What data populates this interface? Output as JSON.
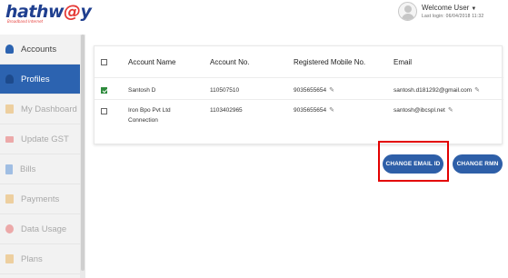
{
  "header": {
    "logo_main": "hathw",
    "logo_at": "@",
    "logo_end": "y",
    "logo_tagline": "Broadband Internet",
    "welcome": "Welcome User",
    "user_sub": "Last login: 06/04/2018 11:32"
  },
  "sidebar": {
    "items": [
      {
        "label": "Accounts",
        "icon": "person-icon",
        "color": "#2c63b0"
      },
      {
        "label": "Profiles",
        "icon": "person-icon",
        "color": "#2c63b0"
      },
      {
        "label": "My Dashboard",
        "icon": "home-icon",
        "color": "#e7a43a"
      },
      {
        "label": "Update GST",
        "icon": "gst-icon",
        "color": "#e55050"
      },
      {
        "label": "Bills",
        "icon": "bill-icon",
        "color": "#3b7fd1"
      },
      {
        "label": "Payments",
        "icon": "wallet-icon",
        "color": "#e7a43a"
      },
      {
        "label": "Data Usage",
        "icon": "pie-icon",
        "color": "#e55050"
      },
      {
        "label": "Plans",
        "icon": "plan-icon",
        "color": "#e7a43a"
      }
    ]
  },
  "table": {
    "headers": [
      "Account Name",
      "Account No.",
      "Registered Mobile No.",
      "Email"
    ],
    "rows": [
      {
        "name": "Santosh D",
        "name2": "",
        "account": "110507510",
        "mobile": "9035655654",
        "email": "santosh.d181292@gmail.com",
        "checked": true
      },
      {
        "name": "Iron Bpo Pvt Ltd",
        "name2": "Connection",
        "account": "1103402965",
        "mobile": "9035655654",
        "email": "santosh@ibcspl.net",
        "checked": false
      }
    ]
  },
  "actions": {
    "change_email": "CHANGE EMAIL ID",
    "change_rmn": "CHANGE RMN"
  },
  "colors": {
    "active_nav": "#2c63b0",
    "button": "#2e5fa8",
    "highlight": "#e30000",
    "checkbox_checked": "#2e8b3d"
  }
}
